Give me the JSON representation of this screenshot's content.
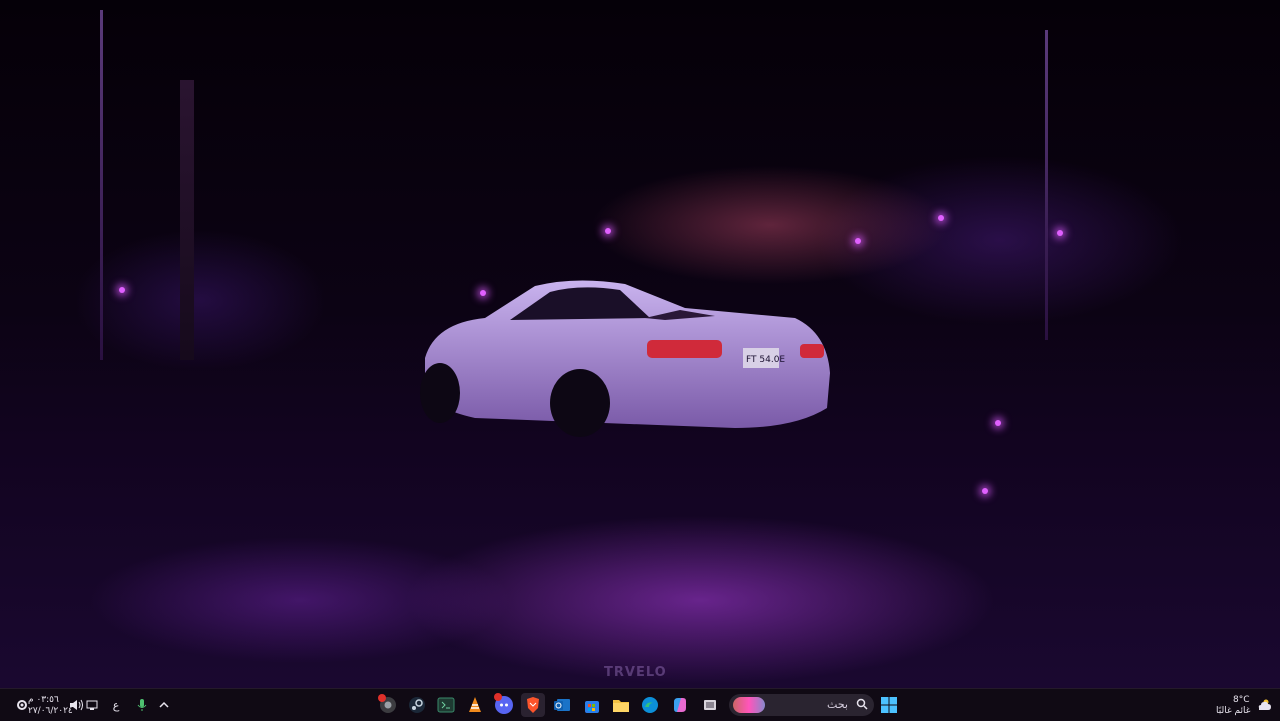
{
  "wallpaper": {
    "watermark": "TRVELO",
    "plate": "FT 54.0E"
  },
  "taskbar": {
    "clock": {
      "time": "٠٣:٥٦ م",
      "date": "٢٧/٠٦/٢٠٢٤"
    },
    "language": "ع",
    "search": {
      "placeholder": "بحث"
    },
    "weather": {
      "temperature": "8°C",
      "condition": "غائم غالبًا"
    },
    "apps": [
      {
        "name": "chrome"
      },
      {
        "name": "steam"
      },
      {
        "name": "terminal"
      },
      {
        "name": "vlc"
      },
      {
        "name": "discord"
      },
      {
        "name": "brave"
      },
      {
        "name": "outlook"
      },
      {
        "name": "store"
      },
      {
        "name": "file-explorer"
      },
      {
        "name": "edge"
      },
      {
        "name": "copilot"
      },
      {
        "name": "task-view"
      }
    ],
    "colors": {
      "background": "#100a14",
      "accent": "#a050e0"
    }
  }
}
